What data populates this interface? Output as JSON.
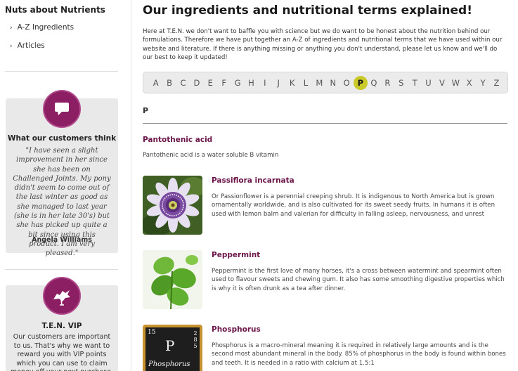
{
  "sidebar": {
    "heading": "Nuts about Nutrients",
    "links": [
      {
        "label": "A-Z Ingredients"
      },
      {
        "label": "Articles"
      }
    ],
    "testimonial": {
      "icon": "speech-bubble-icon",
      "title": "What our customers think",
      "quote": "\"I have seen a slight improvement in her since she has been on Challenged Joints. My pony didn't seem to come out of the last winter as good as she managed to last year (she is in her late 30's) but she has picked up quite a bit since using this product. I am very pleased.\"",
      "author": "Angela Williams"
    },
    "vip": {
      "icon": "horse-emblem-icon",
      "title": "T.E.N. VIP",
      "text": "Our customers are important to us. That's why we want to reward you with VIP points which you can use to claim money off your next purchase."
    }
  },
  "main": {
    "title": "Our ingredients and nutritional terms explained!",
    "intro": "Here at T.E.N. we don't want to baffle you with science but we do want to be honest about the nutrition behind our formulations. Therefore we have put together an A-Z of ingredients and nutritional terms that we have used within our website and literature. If there is anything missing or anything you don't understand, please let us know and we'll do our best to keep it updated!",
    "alphabet": [
      "A",
      "B",
      "C",
      "D",
      "E",
      "F",
      "G",
      "H",
      "I",
      "J",
      "K",
      "L",
      "M",
      "N",
      "O",
      "P",
      "Q",
      "R",
      "S",
      "T",
      "U",
      "V",
      "W",
      "X",
      "Y",
      "Z"
    ],
    "active_letter": "P",
    "section_letter": "P",
    "first_entry": {
      "title": "Pantothenic acid",
      "desc": "Pantothenic acid is a water soluble B vitamin"
    },
    "entries": [
      {
        "title": "Passiflora incarnata",
        "desc": "Or Passionflower is a perennial creeping shrub. It is indigenous to North America but is grown ornamentally worldwide, and is also cultivated for its sweet seedy fruits. In humans it is often used with lemon balm and valerian for difficulty in falling asleep, nervousness, and unrest",
        "image": "passionflower-image"
      },
      {
        "title": "Peppermint",
        "desc": "Peppermint is the first love of many horses, it's a cross between watermint and spearmint often used to flavour sweets and chewing gum. It also has some smoothing digestive properties which is why it is often drunk as a tea after dinner.",
        "image": "peppermint-leaves-image"
      },
      {
        "title": "Phosphorus",
        "desc": "Phosphorus is a macro-mineral meaning it is required in relatively large amounts and is the second most abundant mineral in the body. 85% of phosphorus in the body is found within bones and teeth. It is needed in a ratio with calcium at 1.5:1",
        "image": "phosphorus-element-tile-image",
        "tile": {
          "number": "15",
          "symbol": "P",
          "shells": "2 8 5",
          "name": "Phosphorus"
        }
      }
    ]
  },
  "colors": {
    "accent": "#6b1549",
    "icon_circle": "#8c1e63",
    "active_letter_bg": "#c9c928",
    "card_bg": "#e9e9e9"
  }
}
